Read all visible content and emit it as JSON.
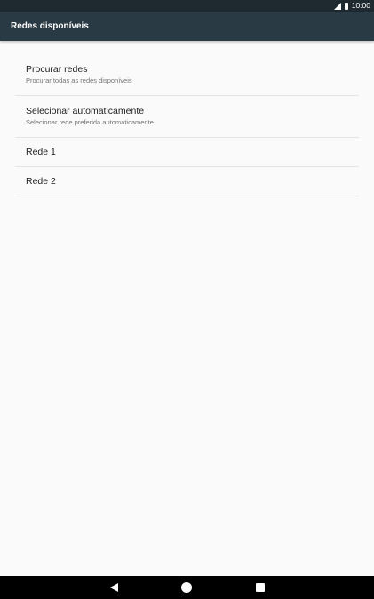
{
  "status_bar": {
    "time": "10:00",
    "icons": [
      "signal-icon",
      "battery-icon"
    ]
  },
  "app_bar": {
    "title": "Redes disponíveis"
  },
  "list": {
    "items": [
      {
        "primary": "Procurar redes",
        "secondary": "Procurar todas as redes disponíveis"
      },
      {
        "primary": "Selecionar automaticamente",
        "secondary": "Selecionar rede preferida automaticamente"
      },
      {
        "primary": "Rede 1"
      },
      {
        "primary": "Rede 2"
      }
    ]
  },
  "nav_bar": {
    "icons": [
      "back-icon",
      "home-icon",
      "recents-icon"
    ]
  },
  "colors": {
    "status_bar": "#1f2a30",
    "app_bar": "#2a3a44",
    "background": "#fafafa",
    "divider": "#e4e4e4",
    "nav_bar": "#000000"
  }
}
